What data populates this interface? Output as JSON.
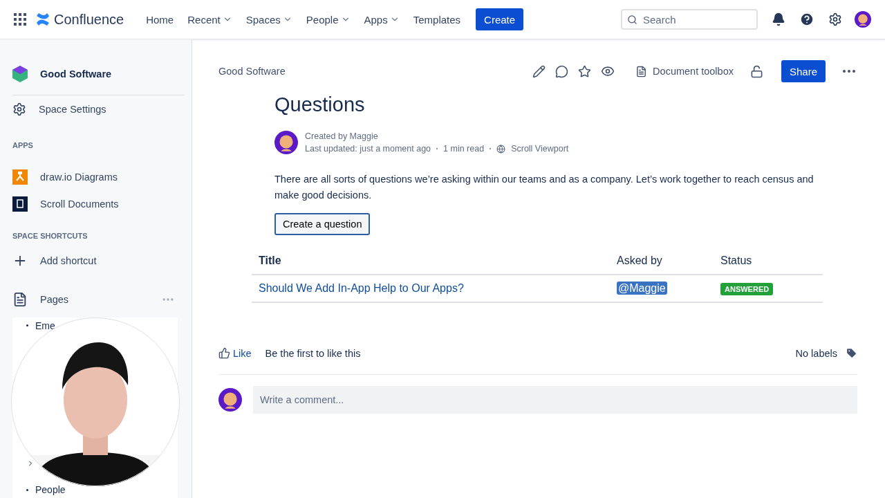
{
  "top_bar": {
    "product": "Confluence",
    "nav": [
      {
        "label": "Home",
        "dropdown": false
      },
      {
        "label": "Recent",
        "dropdown": true
      },
      {
        "label": "Spaces",
        "dropdown": true
      },
      {
        "label": "People",
        "dropdown": true
      },
      {
        "label": "Apps",
        "dropdown": true
      },
      {
        "label": "Templates",
        "dropdown": false
      }
    ],
    "create_button": "Create",
    "search": {
      "placeholder": "Search"
    }
  },
  "sidebar": {
    "space": "Good Software",
    "settings": "Space Settings",
    "apps_heading": "APPS",
    "apps": [
      {
        "label": "draw.io Diagrams",
        "kind": "drawio"
      },
      {
        "label": "Scroll Documents",
        "kind": "scroll"
      }
    ],
    "shortcuts_heading": "SPACE SHORTCUTS",
    "add_shortcut": "Add shortcut",
    "pages": "Pages",
    "page_tree": [
      {
        "label": "Eme",
        "kind": "bullet"
      },
      {
        "kind": "folder",
        "expanded": false
      },
      {
        "label": "People",
        "kind": "bullet"
      }
    ]
  },
  "page": {
    "breadcrumb": "Good Software",
    "document_toolbox": "Document toolbox",
    "share_button": "Share",
    "title": "Questions",
    "byline": {
      "created": "Created by Maggie",
      "updated": "Last updated: just a moment ago",
      "read_time": "1 min read",
      "viewport": "Scroll Viewport"
    },
    "body": "There are all sorts of questions we’re asking within our teams and as a company. Let’s work together to reach census and make good decisions.",
    "action_button": "Create a question",
    "table": {
      "columns": [
        "Title",
        "Asked by",
        "Status"
      ],
      "rows": [
        {
          "title": "Should We Add In-App Help to Our Apps?",
          "asked_by": "@Maggie",
          "status": "ANSWERED",
          "color": "#22a03a"
        }
      ]
    },
    "like": "Like",
    "like_text": "Be the first to like this",
    "labels": "No labels",
    "comment": {
      "placeholder": "Write a comment..."
    }
  }
}
